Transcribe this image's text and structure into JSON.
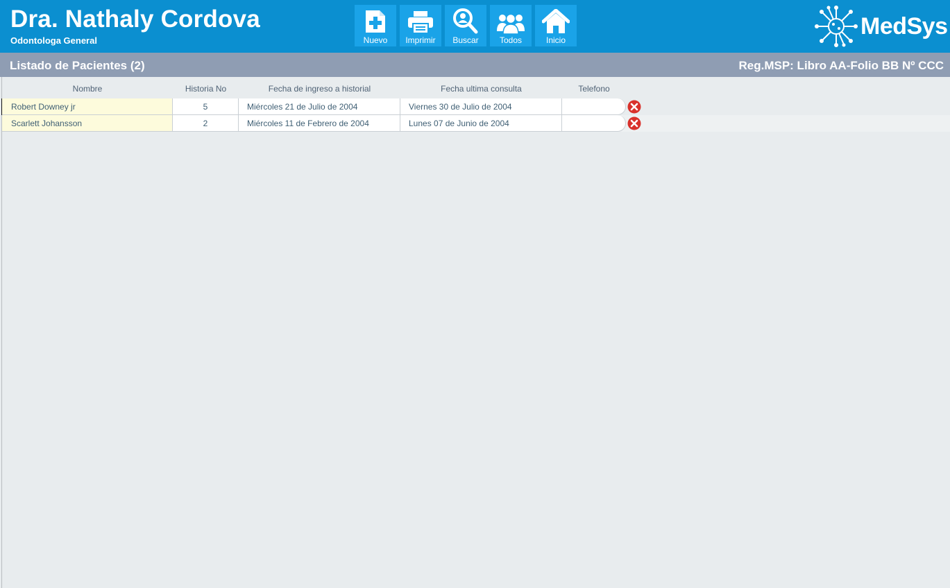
{
  "header": {
    "doctor_name": "Dra. Nathaly Cordova",
    "doctor_title": "Odontologa General",
    "accent_color": "#0b8fd0",
    "toolbar": [
      {
        "label": "Nuevo",
        "icon": "new-document-icon"
      },
      {
        "label": "Imprimir",
        "icon": "printer-icon"
      },
      {
        "label": "Buscar",
        "icon": "search-icon"
      },
      {
        "label": "Todos",
        "icon": "users-icon"
      },
      {
        "label": "Inicio",
        "icon": "home-icon"
      }
    ],
    "logo_text": "MedSys"
  },
  "subbar": {
    "list_title": "Listado de Pacientes (2)",
    "registration": "Reg.MSP: Libro AA-Folio BB Nº CCC"
  },
  "table": {
    "columns": [
      "Nombre",
      "Historia No",
      "Fecha de ingreso a historial",
      "Fecha ultima consulta",
      "Telefono"
    ],
    "rows": [
      {
        "nombre": "Robert Downey jr",
        "historia": "5",
        "ingreso": "Miércoles 21 de Julio de 2004",
        "ultima": "Viernes 30 de Julio de 2004",
        "telefono": ""
      },
      {
        "nombre": "Scarlett Johansson",
        "historia": "2",
        "ingreso": "Miércoles 11 de Febrero de 2004",
        "ultima": "Lunes 07 de Junio de 2004",
        "telefono": ""
      }
    ],
    "delete_icon": "delete-circle-icon",
    "delete_color": "#d9312b"
  }
}
